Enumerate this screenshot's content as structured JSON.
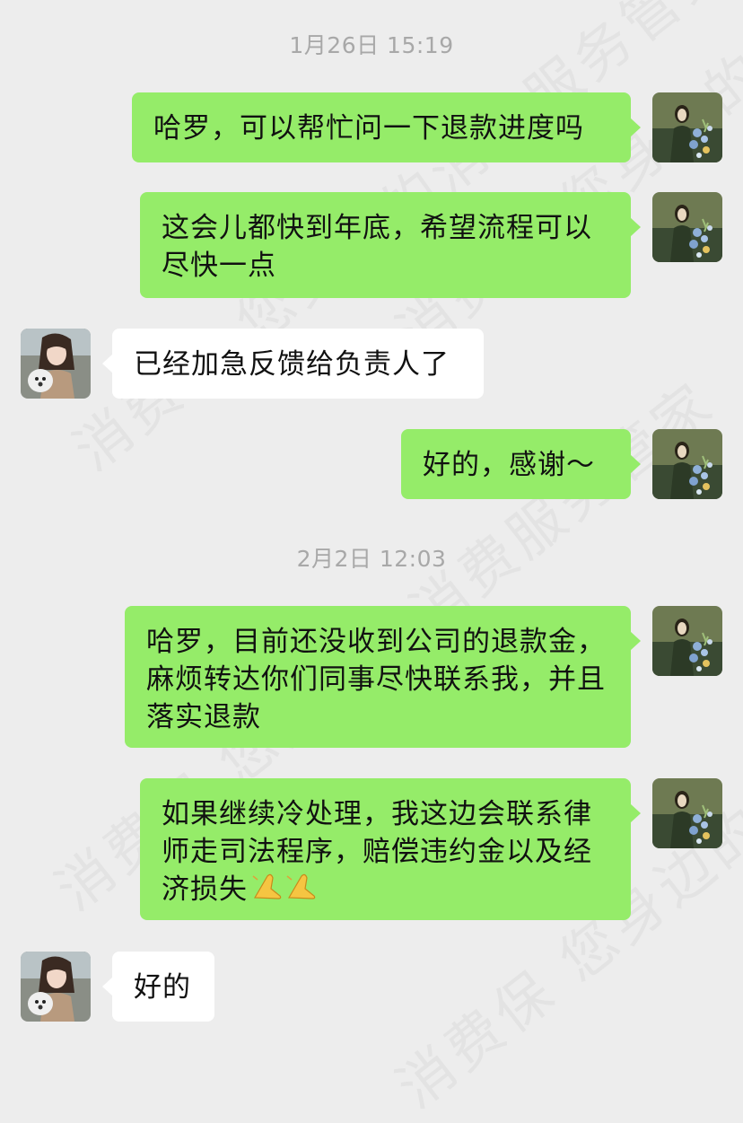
{
  "watermark_text": "消费保 您身边的消费服务管家",
  "colors": {
    "background": "#ededed",
    "sent_bubble": "#95ec69",
    "received_bubble": "#ffffff",
    "timestamp": "#a8a8a8"
  },
  "chat": {
    "timestamps": [
      "1月26日 15:19",
      "2月2日 12:03"
    ],
    "messages": [
      {
        "side": "right",
        "text": "哈罗，可以帮忙问一下退款进度吗"
      },
      {
        "side": "right",
        "text": "这会儿都快到年底，希望流程可以尽快一点"
      },
      {
        "side": "left",
        "text": "已经加急反馈给负责人了"
      },
      {
        "side": "right",
        "text": "好的，感谢～"
      },
      {
        "side": "right",
        "text": "哈罗，目前还没收到公司的退款金，麻烦转达你们同事尽快联系我，并且落实退款"
      },
      {
        "side": "right",
        "text": "如果继续冷处理，我这边会联系律师走司法程序，赔偿违约金以及经济损失",
        "emoji": "folded-hands-icon"
      },
      {
        "side": "left",
        "text": "好的"
      }
    ]
  }
}
